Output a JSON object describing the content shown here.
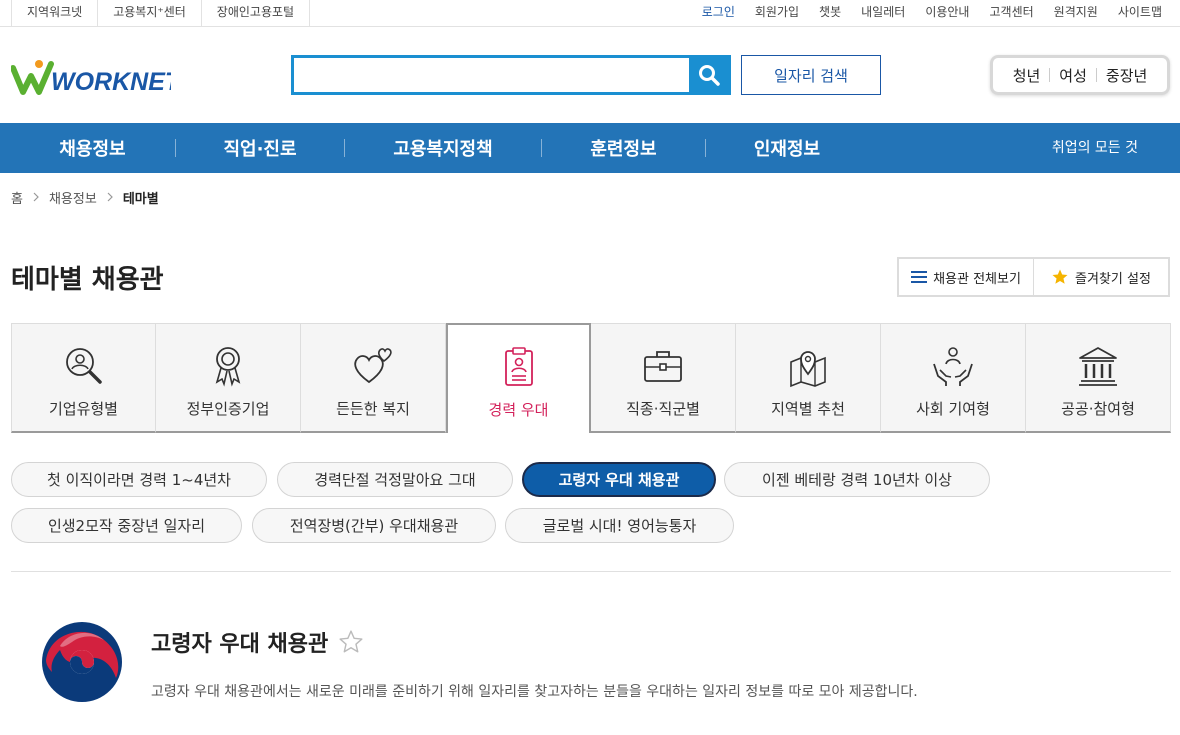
{
  "util": {
    "left_links": [
      "지역워크넷",
      "고용복지⁺센터",
      "장애인고용포털"
    ],
    "right_links": [
      "로그인",
      "회원가입",
      "챗봇",
      "내일레터",
      "이용안내",
      "고객센터",
      "원격지원",
      "사이트맵"
    ]
  },
  "header": {
    "logo_text": "WORKNET",
    "search_placeholder": "",
    "job_search_label": "일자리 검색",
    "target_links": [
      "청년",
      "여성",
      "중장년"
    ]
  },
  "gnb": {
    "items": [
      "채용정보",
      "직업·진로",
      "고용복지정책",
      "훈련정보",
      "인재정보"
    ],
    "right_label": "취업의 모든 것"
  },
  "breadcrumb": [
    "홈",
    "채용정보",
    "테마별"
  ],
  "page": {
    "title": "테마별 채용관",
    "btn_all": "채용관 전체보기",
    "btn_fav": "즐겨찾기 설정"
  },
  "tabs": [
    {
      "label": "기업유형별",
      "icon": "magnifier-person-icon"
    },
    {
      "label": "정부인증기업",
      "icon": "award-medal-icon"
    },
    {
      "label": "든든한 복지",
      "icon": "hearts-icon"
    },
    {
      "label": "경력 우대",
      "icon": "clipboard-person-icon",
      "active": true
    },
    {
      "label": "직종·직군별",
      "icon": "briefcase-icon"
    },
    {
      "label": "지역별 추천",
      "icon": "map-pin-icon"
    },
    {
      "label": "사회 기여형",
      "icon": "hands-people-icon"
    },
    {
      "label": "공공·참여형",
      "icon": "public-building-icon"
    }
  ],
  "chips": [
    {
      "label": "첫 이직이라면 경력 1~4년차"
    },
    {
      "label": "경력단절 걱정말아요 그대"
    },
    {
      "label": "고령자 우대 채용관",
      "active": true
    },
    {
      "label": "이젠 베테랑 경력 10년차 이상"
    },
    {
      "label": "인생2모작 중장년 일자리"
    },
    {
      "label": "전역장병(간부) 우대채용관"
    },
    {
      "label": "글로벌 시대! 영어능통자"
    }
  ],
  "section": {
    "title": "고령자 우대 채용관",
    "description": "고령자 우대 채용관에서는 새로운 미래를 준비하기 위해 일자리를 찾고자하는 분들을 우대하는 일자리 정보를 따로 모아 제공합니다."
  },
  "colors": {
    "brand_blue": "#2374b7",
    "search_blue": "#1a8fd1",
    "active_chip": "#0e5da8",
    "active_tab_text": "#d3225b",
    "logo_green": "#5ab031"
  }
}
